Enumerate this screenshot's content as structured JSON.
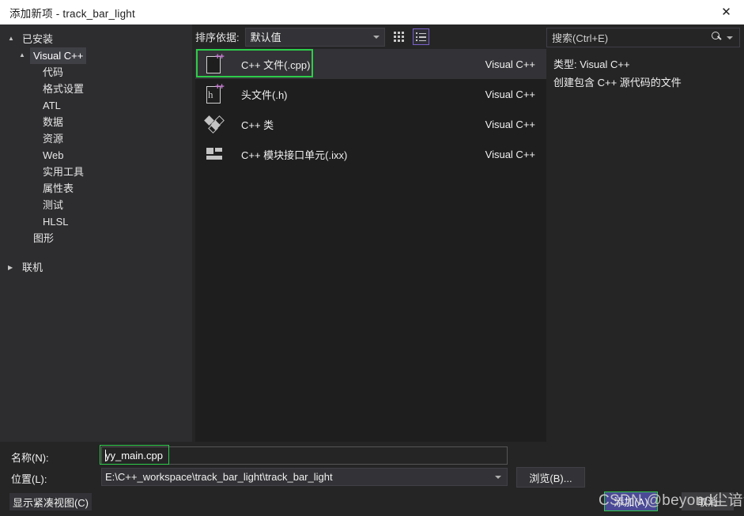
{
  "window": {
    "title": "添加新项 - track_bar_light",
    "close_icon": "close-icon"
  },
  "sidebar": {
    "root_label": "已安装",
    "items": [
      {
        "label": "Visual C++",
        "level": 1,
        "arrow": "▲",
        "selected": true
      },
      {
        "label": "代码",
        "level": 2,
        "arrow": "",
        "selected": false
      },
      {
        "label": "格式设置",
        "level": 2,
        "arrow": "",
        "selected": false
      },
      {
        "label": "ATL",
        "level": 2,
        "arrow": "",
        "selected": false
      },
      {
        "label": "数据",
        "level": 2,
        "arrow": "",
        "selected": false
      },
      {
        "label": "资源",
        "level": 2,
        "arrow": "",
        "selected": false
      },
      {
        "label": "Web",
        "level": 2,
        "arrow": "",
        "selected": false
      },
      {
        "label": "实用工具",
        "level": 2,
        "arrow": "",
        "selected": false
      },
      {
        "label": "属性表",
        "level": 2,
        "arrow": "",
        "selected": false
      },
      {
        "label": "测试",
        "level": 2,
        "arrow": "",
        "selected": false
      },
      {
        "label": "HLSL",
        "level": 2,
        "arrow": "",
        "selected": false
      },
      {
        "label": "图形",
        "level": 1,
        "arrow": "",
        "selected": false
      },
      {
        "label": "联机",
        "level": 0,
        "arrow": "▶",
        "selected": false
      }
    ]
  },
  "toolbar": {
    "sort_label": "排序依据:",
    "sort_value": "默认值",
    "grid_view_icon": "grid-view-icon",
    "list_view_icon": "list-view-icon"
  },
  "templates": {
    "items": [
      {
        "name": "C++ 文件(.cpp)",
        "origin": "Visual C++",
        "icon": "cpp-file-icon",
        "selected": true
      },
      {
        "name": "头文件(.h)",
        "origin": "Visual C++",
        "icon": "header-file-icon",
        "selected": false
      },
      {
        "name": "C++ 类",
        "origin": "Visual C++",
        "icon": "cpp-class-icon",
        "selected": false
      },
      {
        "name": "C++ 模块接口单元(.ixx)",
        "origin": "Visual C++",
        "icon": "cpp-module-icon",
        "selected": false
      }
    ]
  },
  "search": {
    "placeholder": "搜索(Ctrl+E)",
    "icon": "search-icon"
  },
  "details": {
    "type_line": "类型: Visual C++",
    "description": "创建包含 C++ 源代码的文件"
  },
  "bottom": {
    "name_label": "名称(N):",
    "name_value": "yy_main.cpp",
    "location_label": "位置(L):",
    "location_value": "E:\\C++_workspace\\track_bar_light\\track_bar_light",
    "browse_label": "浏览(B)...",
    "compact_label": "显示紧凑视图(C)",
    "add_label": "添加(A)",
    "cancel_label": "取消"
  },
  "watermark": {
    "text": "CSDN @beyond尘谙语"
  },
  "colors": {
    "accent_green": "#2ecc4a",
    "accent_purple": "#7a61c9",
    "button_blue": "#4a4a96",
    "panel_dark": "#1e1e1e",
    "panel_mid": "#252526",
    "panel_light": "#2d2d30"
  }
}
